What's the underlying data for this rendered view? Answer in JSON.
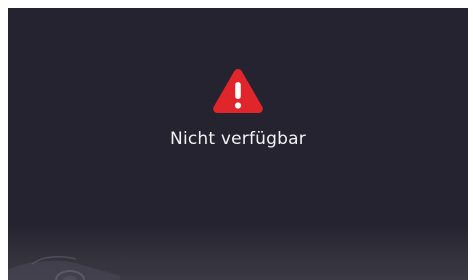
{
  "status": {
    "icon": "warning-icon",
    "icon_color": "#e0262b",
    "message": "Nicht verfügbar"
  },
  "colors": {
    "background": "#24232f",
    "text": "#f2f2f4"
  }
}
